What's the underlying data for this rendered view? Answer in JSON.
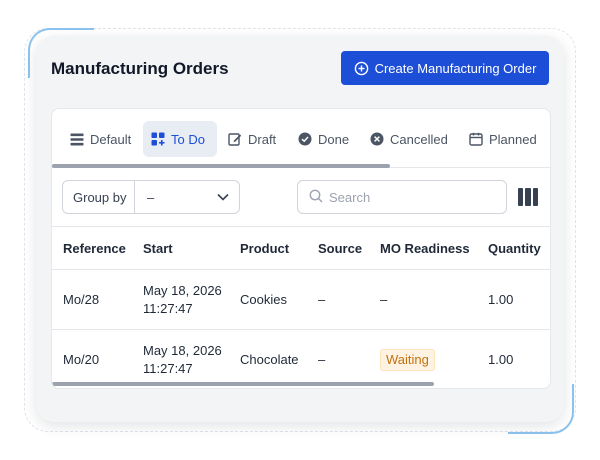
{
  "header": {
    "title": "Manufacturing Orders",
    "create_button": "Create Manufacturing Order"
  },
  "tabs": [
    {
      "label": "Default",
      "icon": "list-icon",
      "active": false
    },
    {
      "label": "To Do",
      "icon": "todo-grid-icon",
      "active": true
    },
    {
      "label": "Draft",
      "icon": "edit-icon",
      "active": false
    },
    {
      "label": "Done",
      "icon": "check-circle-icon",
      "active": false
    },
    {
      "label": "Cancelled",
      "icon": "x-circle-icon",
      "active": false
    },
    {
      "label": "Planned",
      "icon": "calendar-icon",
      "active": false
    }
  ],
  "filters": {
    "group_by_label": "Group by",
    "group_by_value": "–",
    "search_placeholder": "Search"
  },
  "table": {
    "columns": [
      "Reference",
      "Start",
      "Product",
      "Source",
      "MO Readiness",
      "Quantity"
    ],
    "rows": [
      {
        "reference": "Mo/28",
        "start_date": "May 18, 2026",
        "start_time": "11:27:47",
        "product": "Cookies",
        "source": "–",
        "readiness": "–",
        "quantity": "1.00"
      },
      {
        "reference": "Mo/20",
        "start_date": "May 18, 2026",
        "start_time": "11:27:47",
        "product": "Chocolate",
        "source": "–",
        "readiness": "Waiting",
        "quantity": "1.00"
      }
    ]
  },
  "colors": {
    "accent": "#1d4ed8",
    "waiting_badge_text": "#c2710c",
    "waiting_badge_bg": "#fef3e2"
  }
}
